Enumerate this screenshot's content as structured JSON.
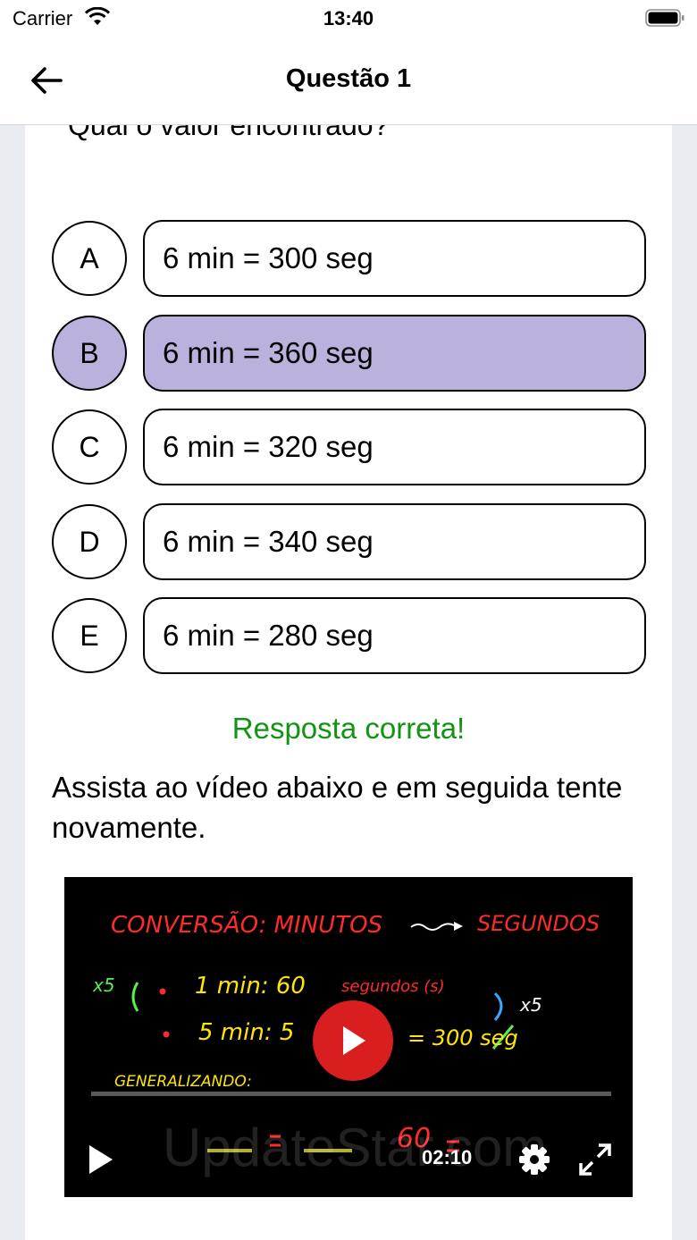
{
  "status_bar": {
    "carrier": "Carrier",
    "time": "13:40"
  },
  "nav": {
    "title": "Questão 1",
    "back_icon": "arrow-left-icon"
  },
  "question": {
    "text": "Qual o valor encontrado?"
  },
  "options": [
    {
      "letter": "A",
      "text": "6 min = 300 seg",
      "selected": false
    },
    {
      "letter": "B",
      "text": "6 min = 360 seg",
      "selected": true
    },
    {
      "letter": "C",
      "text": "6 min = 320 seg",
      "selected": false
    },
    {
      "letter": "D",
      "text": "6 min = 340 seg",
      "selected": false
    },
    {
      "letter": "E",
      "text": "6 min = 280 seg",
      "selected": false
    }
  ],
  "feedback": {
    "text": "Resposta correta!",
    "color": "#119412"
  },
  "instruction": {
    "text": "Assista ao vídeo abaixo e em seguida tente novamente."
  },
  "video": {
    "duration": "02:10",
    "watermark": "UpdateStar.com",
    "board": {
      "title": "CONVERSÃO: MINUTOS",
      "title_right": "SEGUNDOS",
      "line1_label": "1 min: 60",
      "line1_note": "segundos (s)",
      "line2_label": "5 min: 5",
      "line2_result": "= 300 seg",
      "multiplier_left": "x5",
      "multiplier_right": "x5",
      "generalize": "GENERALIZANDO:",
      "bottom_value": "60"
    }
  },
  "colors": {
    "selected_bg": "#bab2dc",
    "play_button": "#d81e1e"
  }
}
